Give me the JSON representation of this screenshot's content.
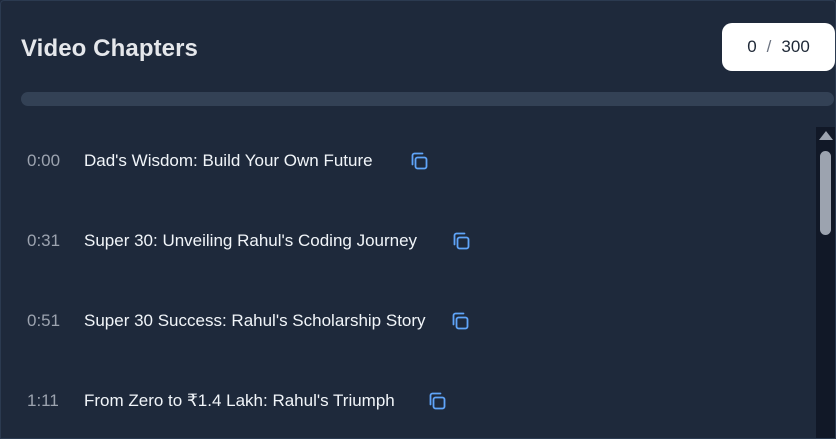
{
  "header": {
    "title": "Video Chapters",
    "counter_current": "0",
    "counter_separator": "/",
    "counter_total": "300"
  },
  "progress": {
    "fraction": 0.0,
    "fill_color": "#60a5fa",
    "track_color": "#334155"
  },
  "chapters": [
    {
      "time": "0:00",
      "title": "Dad's Wisdom: Build Your Own Future",
      "icon": "copy-icon"
    },
    {
      "time": "0:31",
      "title": "Super 30: Unveiling Rahul's Coding Journey",
      "icon": "copy-icon"
    },
    {
      "time": "0:51",
      "title": "Super 30 Success: Rahul's Scholarship Story",
      "icon": "copy-icon"
    },
    {
      "time": "1:11",
      "title": "From Zero to ₹1.4 Lakh: Rahul's Triumph",
      "icon": "copy-icon"
    }
  ],
  "colors": {
    "background": "#1e293b",
    "icon_accent": "#60a5fa"
  }
}
